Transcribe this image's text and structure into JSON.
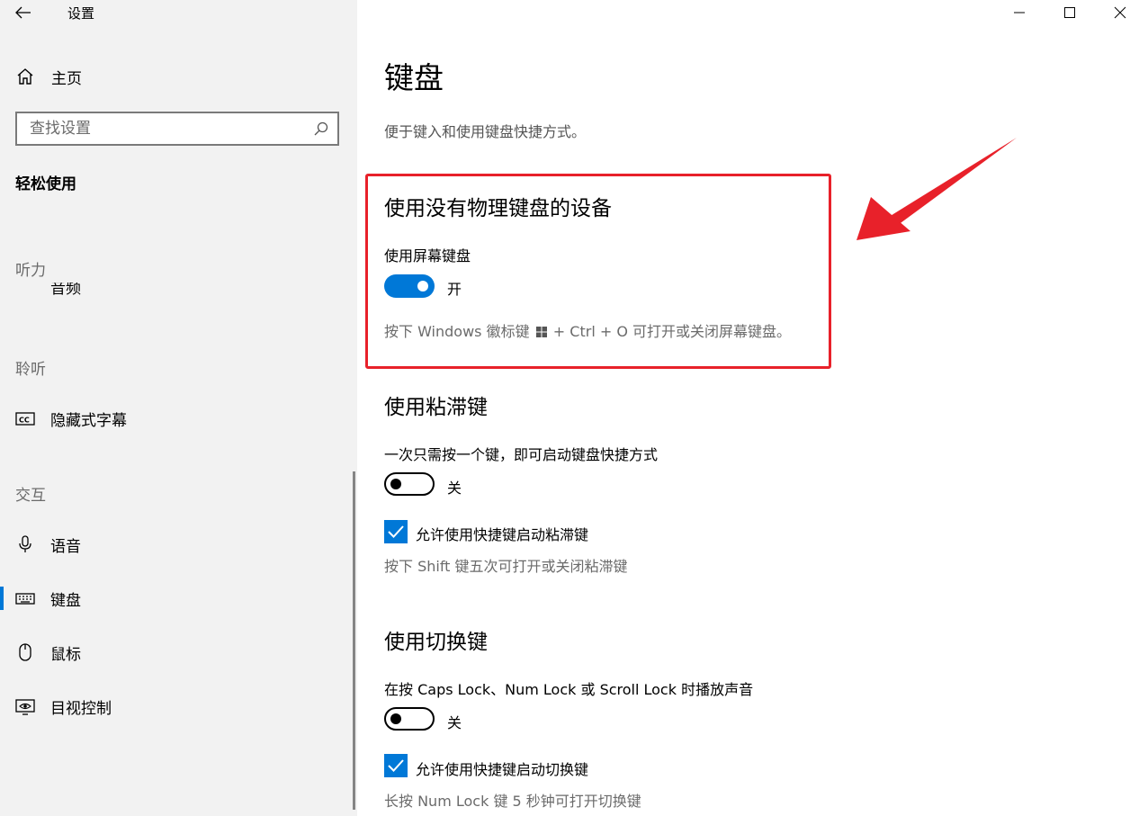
{
  "app": {
    "title": "设置"
  },
  "sidebar": {
    "home": "主页",
    "search_placeholder": "查找设置",
    "section": "轻松使用",
    "groups": [
      {
        "header": "听力"
      },
      {
        "header": "聆听"
      },
      {
        "header": "交互"
      }
    ],
    "partial_item": "音频",
    "items": [
      {
        "label": "隐藏式字幕",
        "icon": "cc-icon"
      },
      {
        "label": "语音",
        "icon": "microphone-icon"
      },
      {
        "label": "键盘",
        "icon": "keyboard-icon",
        "active": true
      },
      {
        "label": "鼠标",
        "icon": "mouse-icon"
      },
      {
        "label": "目视控制",
        "icon": "eye-control-icon"
      }
    ]
  },
  "main": {
    "title": "键盘",
    "description": "便于键入和使用键盘快捷方式。",
    "onscreen": {
      "heading": "使用没有物理键盘的设备",
      "setting_label": "使用屏幕键盘",
      "toggle_state": "开",
      "hint_pre": "按下 Windows 徽标键",
      "hint_post": "+ Ctrl + O 可打开或关闭屏幕键盘。"
    },
    "sticky": {
      "heading": "使用粘滞键",
      "setting_label": "一次只需按一个键，即可启动键盘快捷方式",
      "toggle_state": "关",
      "checkbox_label": "允许使用快捷键启动粘滞键",
      "hint": "按下 Shift 键五次可打开或关闭粘滞键"
    },
    "toggle_keys": {
      "heading": "使用切换键",
      "setting_label": "在按 Caps Lock、Num Lock 或 Scroll Lock 时播放声音",
      "toggle_state": "关",
      "checkbox_label": "允许使用快捷键启动切换键",
      "hint": "长按 Num Lock 键 5 秒钟可打开切换键"
    }
  },
  "colors": {
    "accent": "#0078d7",
    "highlight": "#e8212a",
    "sidebar_bg": "#f2f2f2"
  }
}
